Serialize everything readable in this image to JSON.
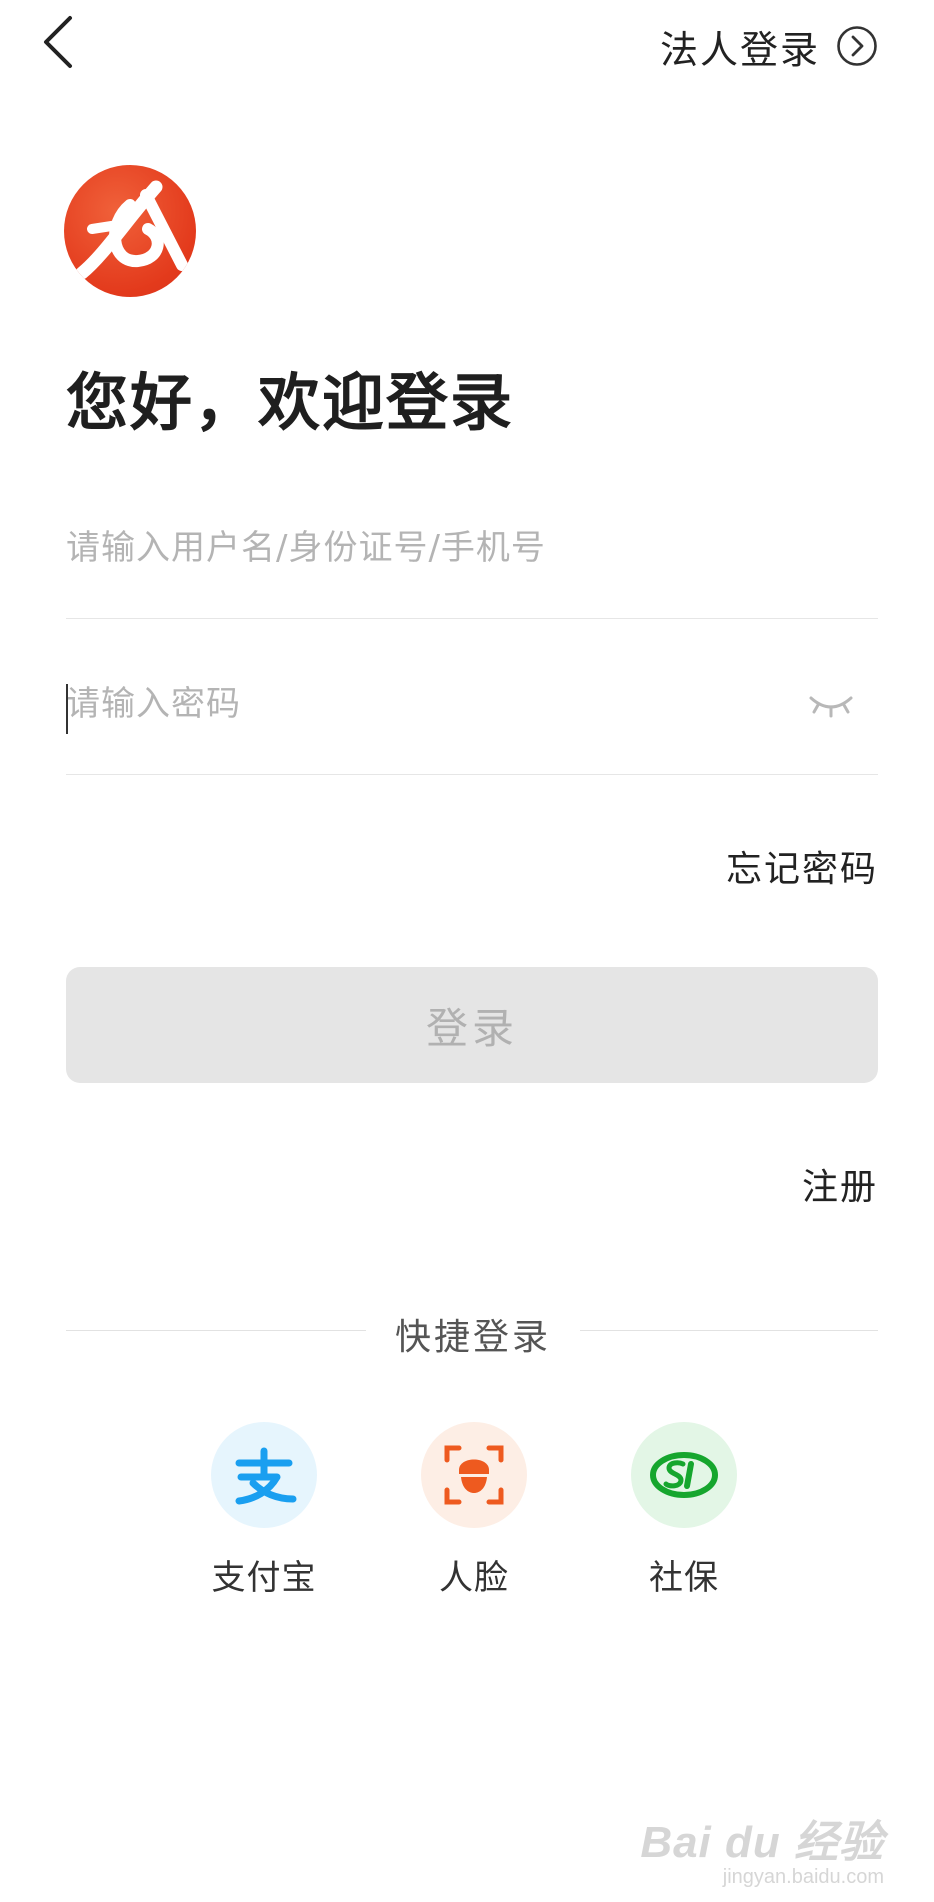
{
  "header": {
    "legal_login_label": "法人登录"
  },
  "greeting": "您好，欢迎登录",
  "form": {
    "username_placeholder": "请输入用户名/身份证号/手机号",
    "username_value": "",
    "password_placeholder": "请输入密码",
    "password_value": ""
  },
  "forgot_password_label": "忘记密码",
  "login_button_label": "登录",
  "register_label": "注册",
  "quick_login": {
    "title": "快捷登录",
    "items": [
      {
        "label": "支付宝",
        "icon": "alipay-icon",
        "color": "#1a9ff0",
        "bg": "#e6f5fd"
      },
      {
        "label": "人脸",
        "icon": "face-scan-icon",
        "color": "#ee5a1f",
        "bg": "#fdeee5"
      },
      {
        "label": "社保",
        "icon": "social-security-icon",
        "color": "#16a62e",
        "bg": "#e3f6e6"
      }
    ]
  },
  "watermark": {
    "main": "Bai du 经验",
    "sub": "jingyan.baidu.com"
  },
  "colors": {
    "brand": "#e33a1c",
    "login_button_bg": "#e5e5e5",
    "login_button_text": "#b1b1b1"
  }
}
